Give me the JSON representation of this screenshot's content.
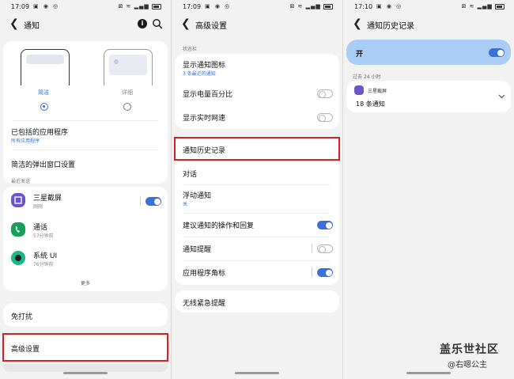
{
  "panel1": {
    "status": {
      "time": "17:09"
    },
    "title": "通知",
    "styles": {
      "brief": "简洁",
      "detailed": "详细"
    },
    "included_apps": {
      "label": "已包括的应用程序",
      "sub": "所有应用程序"
    },
    "popup": {
      "label": "简洁的弹出窗口设置"
    },
    "recent_header": "最近发送",
    "apps": [
      {
        "name": "三星截屏",
        "time": "刚刚",
        "color": "#6b55c9"
      },
      {
        "name": "通话",
        "time": "57分钟前",
        "color": "#15a258"
      },
      {
        "name": "系统 UI",
        "time": "76分钟前",
        "color": "#18b887"
      }
    ],
    "more": "更多",
    "dnd": "免打扰",
    "advanced": "高级设置"
  },
  "panel2": {
    "status": {
      "time": "17:09"
    },
    "title": "高级设置",
    "section": "状态栏",
    "show_icons": {
      "label": "显示通知图标",
      "sub": "3 条最近的通知"
    },
    "battery": "显示电量百分比",
    "speed": "显示实时网速",
    "history": "通知历史记录",
    "dialog": "对话",
    "floating": {
      "label": "浮动通知",
      "sub": "关"
    },
    "suggest": "建议通知的操作和回复",
    "reminder": "通知提醒",
    "badge": "应用程序角标",
    "alerts": "无线紧急提醒"
  },
  "panel3": {
    "status": {
      "time": "17:10"
    },
    "title": "通知历史记录",
    "master": "开",
    "period": "过去 24 小时",
    "app": {
      "name": "三星截屏",
      "count": "18 条通知"
    }
  },
  "watermark": {
    "line1": "盖乐世社区",
    "line2": "@右嗯公主"
  }
}
